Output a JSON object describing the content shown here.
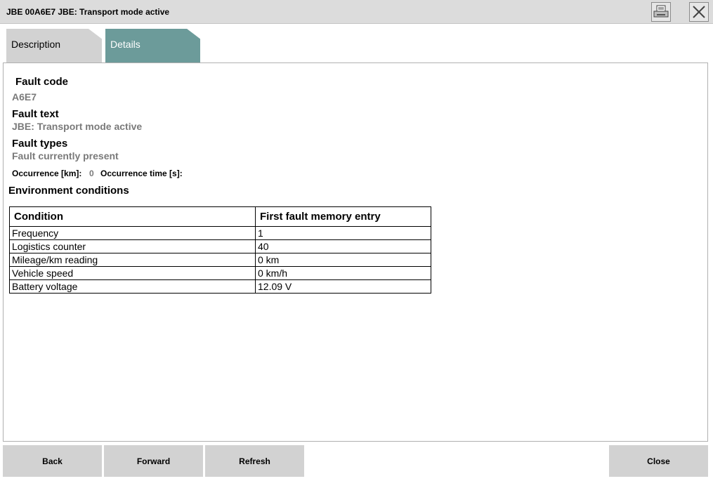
{
  "window": {
    "title": "JBE 00A6E7 JBE: Transport mode active"
  },
  "tabs": [
    {
      "label": "Description",
      "active": false
    },
    {
      "label": "Details",
      "active": true
    }
  ],
  "details": {
    "fault_code_label": "Fault code",
    "fault_code_value": "A6E7",
    "fault_text_label": "Fault text",
    "fault_text_value": "JBE: Transport mode active",
    "fault_types_label": "Fault types",
    "fault_types_value": "Fault currently present",
    "occurrence_km_label": "Occurrence [km]:",
    "occurrence_km_value": "0",
    "occurrence_time_label": "Occurrence time [s]:",
    "environment_title": "Environment conditions"
  },
  "table": {
    "headers": [
      "Condition",
      "First fault memory entry"
    ],
    "rows": [
      [
        "Frequency",
        "1"
      ],
      [
        "Logistics counter",
        "40"
      ],
      [
        "Mileage/km reading",
        "0 km"
      ],
      [
        "Vehicle speed",
        "0 km/h"
      ],
      [
        "Battery voltage",
        "12.09 V"
      ]
    ]
  },
  "footer": {
    "back": "Back",
    "forward": "Forward",
    "refresh": "Refresh",
    "close": "Close"
  },
  "colors": {
    "active_tab": "#6c9b9a",
    "inactive_tab": "#d2d2d2",
    "titlebar": "#dcdcdc",
    "value_text": "#7a7a7a"
  },
  "icons": {
    "print": "printer-icon",
    "close": "close-icon"
  }
}
